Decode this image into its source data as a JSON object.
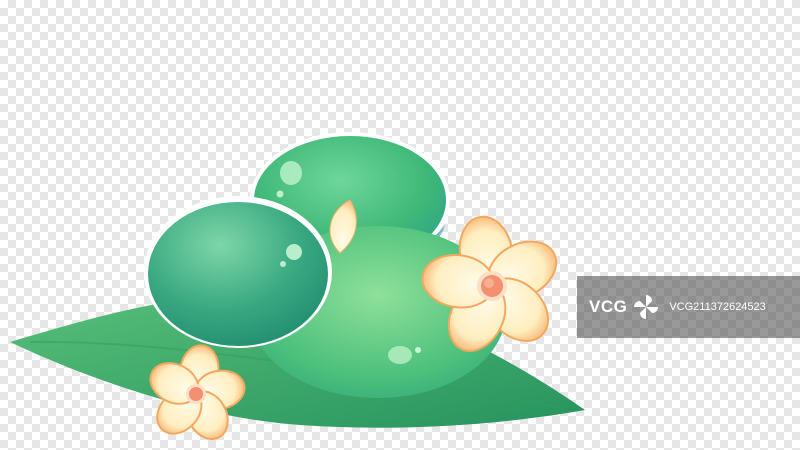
{
  "scene": {
    "description_free": true,
    "palette": {
      "leaf": "#3fae6a",
      "leaf_dark": "#1f8c5a",
      "stone": "#3cb87a",
      "stone_dark": "#1d8f6b",
      "stone_teal": "#2fa39a",
      "petal": "#fff6dc",
      "petal_edge": "#f2a25a",
      "flower_center": "#f08a62"
    }
  },
  "watermark": {
    "logo_text": "VCG",
    "image_id": "VCG211372624523"
  }
}
